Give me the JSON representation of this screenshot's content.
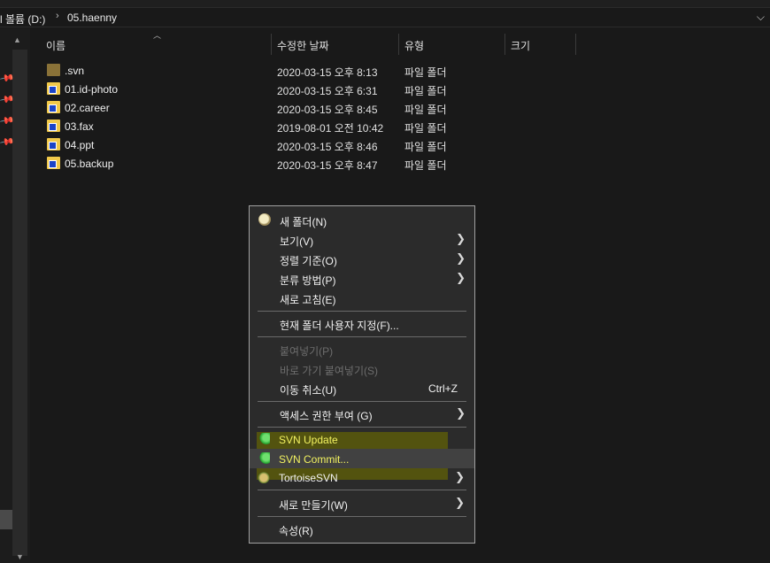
{
  "address": {
    "drive": "l 볼륨 (D:)",
    "separator": "›",
    "folder": "05.haenny",
    "dropdown_icon": "chevron-down-icon"
  },
  "columns": {
    "name": "이름",
    "date": "수정한 날짜",
    "type": "유형",
    "size": "크기"
  },
  "files": [
    {
      "name": ".svn",
      "date": "2020-03-15 오후 8:13",
      "type": "파일 폴더",
      "icon": "folder-icon"
    },
    {
      "name": "01.id-photo",
      "date": "2020-03-15 오후 6:31",
      "type": "파일 폴더",
      "icon": "svn-folder-icon"
    },
    {
      "name": "02.career",
      "date": "2020-03-15 오후 8:45",
      "type": "파일 폴더",
      "icon": "svn-folder-icon"
    },
    {
      "name": "03.fax",
      "date": "2019-08-01 오전 10:42",
      "type": "파일 폴더",
      "icon": "svn-folder-icon"
    },
    {
      "name": "04.ppt",
      "date": "2020-03-15 오후 8:46",
      "type": "파일 폴더",
      "icon": "svn-folder-icon"
    },
    {
      "name": "05.backup",
      "date": "2020-03-15 오후 8:47",
      "type": "파일 폴더",
      "icon": "svn-folder-icon"
    }
  ],
  "context_menu": {
    "new_folder": "새 폴더(N)",
    "view": "보기(V)",
    "sort": "정렬 기준(O)",
    "group": "분류 방법(P)",
    "refresh": "새로 고침(E)",
    "customize": "현재 폴더 사용자 지정(F)...",
    "paste": "붙여넣기(P)",
    "paste_shortcut": "바로 가기 붙여넣기(S)",
    "undo_move": "이동 취소(U)",
    "undo_shortcut": "Ctrl+Z",
    "give_access": "액세스 권한 부여 (G)",
    "svn_update": "SVN Update",
    "svn_commit": "SVN Commit...",
    "tortoise": "TortoiseSVN",
    "new": "새로 만들기(W)",
    "properties": "속성(R)"
  },
  "colors": {
    "background": "#191919",
    "menu_bg": "#2b2b2b",
    "svn_highlight": "#5a5a0a",
    "svn_text": "#f2f260"
  }
}
